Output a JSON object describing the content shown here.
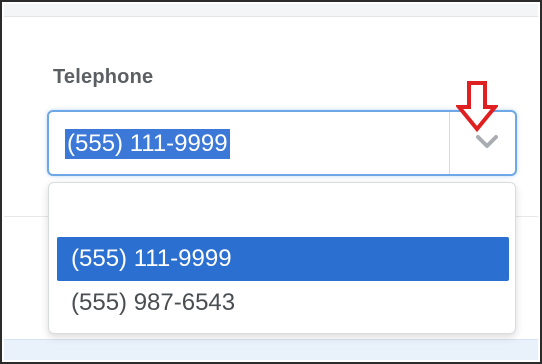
{
  "field": {
    "label": "Telephone",
    "selected_value": "(555) 111-9999"
  },
  "dropdown": {
    "options": [
      {
        "label": "",
        "state": "empty"
      },
      {
        "label": "(555) 111-9999",
        "state": "selected"
      },
      {
        "label": "(555) 987-6543",
        "state": "normal"
      }
    ]
  },
  "icons": {
    "chevron": "chevron-down-icon",
    "callout": "red-down-arrow-callout"
  },
  "colors": {
    "focus_border": "#6ea7e6",
    "selection_highlight": "#3b78d8",
    "selected_option": "#2b6fd0",
    "callout_arrow": "#e02020",
    "label_text": "#5b5f63"
  }
}
